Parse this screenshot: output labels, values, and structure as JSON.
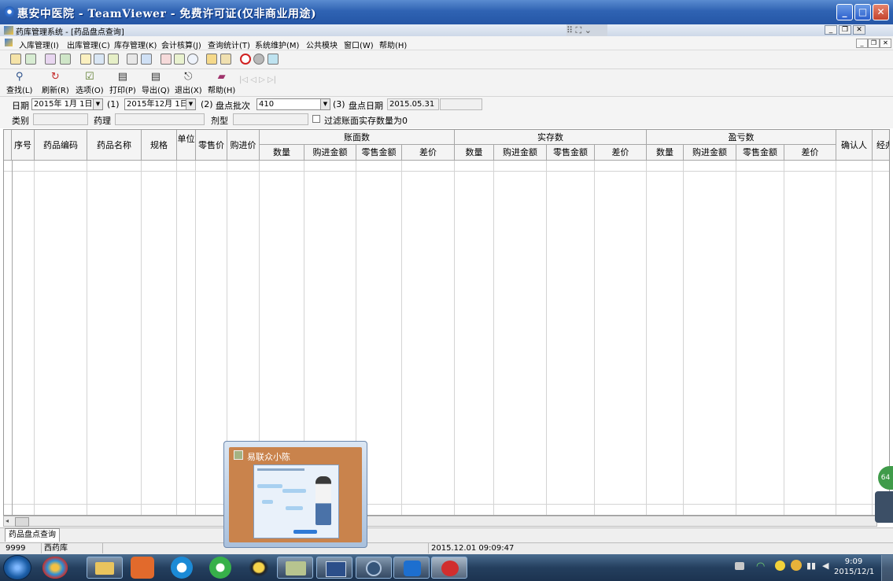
{
  "window": {
    "title": "惠安中医院 - TeamViewer - 免费许可证(仅非商业用途)",
    "inner_title": "药库管理系统 - [药品盘点查询]",
    "tv_tools": "⠿ ⛶ ⌄"
  },
  "menu": [
    {
      "label": "入库管理(I)"
    },
    {
      "label": "出库管理(C)"
    },
    {
      "label": "库存管理(K)"
    },
    {
      "label": "会计核算(J)"
    },
    {
      "label": "查询统计(T)"
    },
    {
      "label": "系统维护(M)"
    },
    {
      "label": "公共模块"
    },
    {
      "label": "窗口(W)"
    },
    {
      "label": "帮助(H)"
    }
  ],
  "toolbar2": [
    {
      "label": "查找(L)",
      "icon": "search-icon",
      "glyph": "🔍"
    },
    {
      "label": "刷新(R)",
      "icon": "refresh-icon",
      "glyph": "♻"
    },
    {
      "label": "选项(O)",
      "icon": "options-icon",
      "glyph": "☑"
    },
    {
      "label": "打印(P)",
      "icon": "print-icon",
      "glyph": "🖶"
    },
    {
      "label": "导出(Q)",
      "icon": "export-icon",
      "glyph": "🖶"
    },
    {
      "label": "退出(X)",
      "icon": "exit-icon",
      "glyph": "⏏"
    },
    {
      "label": "帮助(H)",
      "icon": "help-icon",
      "glyph": "📕"
    }
  ],
  "filter": {
    "date_label": "日期",
    "date_from": "2015年 1月 1日",
    "marker1": "(1)",
    "date_to": "2015年12月 1日",
    "marker2": "(2)",
    "batch_label": "盘点批次",
    "batch_value": "410",
    "marker3": "(3)",
    "count_date_label": "盘点日期",
    "count_date_value": "2015.05.31",
    "category_label": "类别",
    "pharmacology_label": "药理",
    "dosage_label": "剂型",
    "filter_checkbox_label": "过滤账面实存数量为0"
  },
  "grid": {
    "columns": [
      "序号",
      "药品编码",
      "药品名称",
      "规格",
      "单位",
      "零售价",
      "购进价"
    ],
    "groups": [
      {
        "label": "账面数",
        "sub": [
          "数量",
          "购进金额",
          "零售金额",
          "差价"
        ]
      },
      {
        "label": "实存数",
        "sub": [
          "数量",
          "购进金额",
          "零售金额",
          "差价"
        ]
      },
      {
        "label": "盈亏数",
        "sub": [
          "数量",
          "购进金额",
          "零售金额",
          "差价"
        ]
      }
    ],
    "tail_columns": [
      "确认人",
      "经办"
    ]
  },
  "bottom_tab": "药品盘点查询",
  "status": {
    "user_code": "9999",
    "storehouse": "西药库",
    "datetime": "2015.12.01 09:09:47"
  },
  "popup": {
    "title": "易联众小陈"
  },
  "taskbar": {
    "time": "9:09",
    "date": "2015/12/1"
  },
  "float_widget": "64"
}
